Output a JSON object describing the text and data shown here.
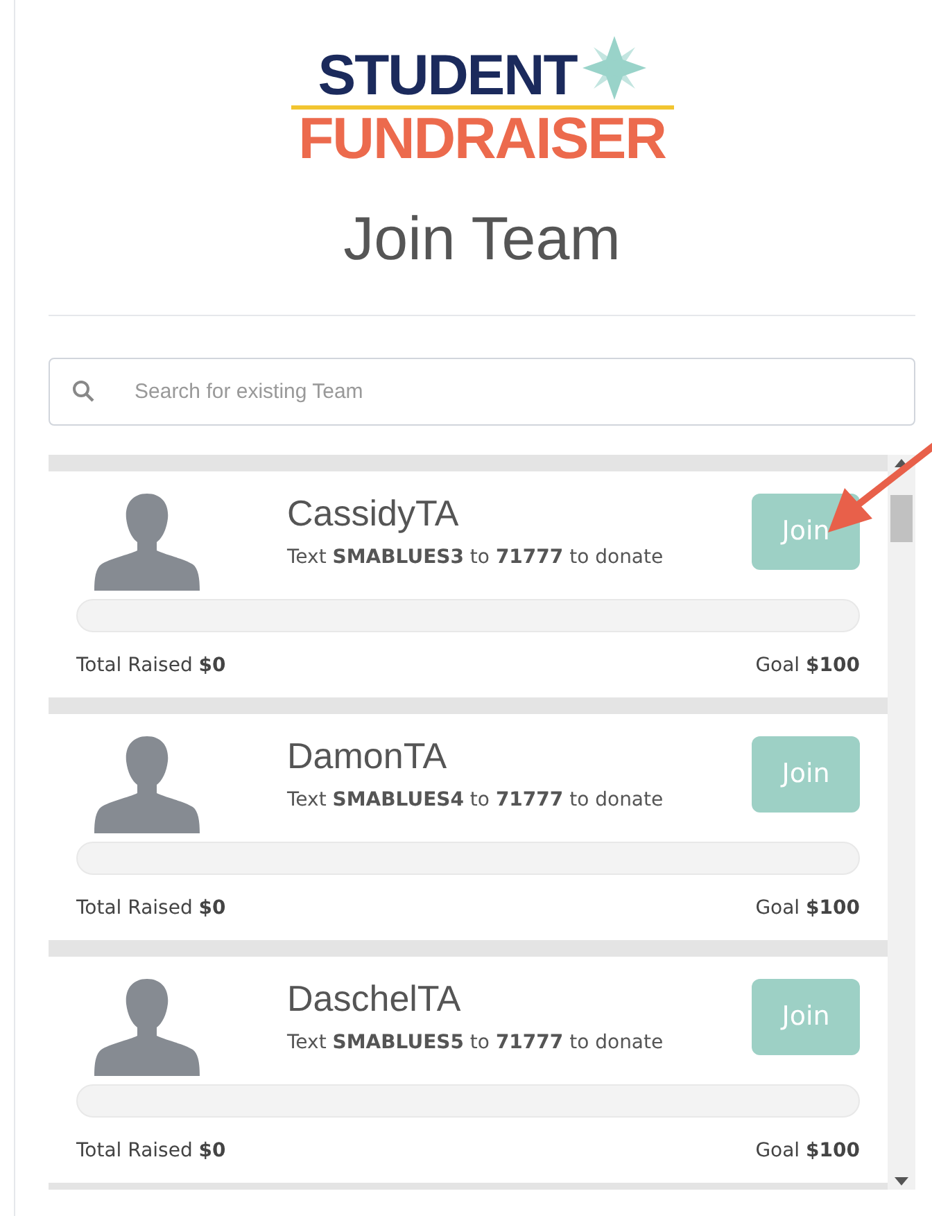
{
  "logo": {
    "line_1": "STUDENT",
    "line_2": "FUNDRAISER"
  },
  "title": "Join Team",
  "search": {
    "placeholder": "Search for existing Team"
  },
  "teams": [
    {
      "name": "CassidyTA",
      "instructions": "Text **SMABLUES3** to **71777** to donate",
      "button": "Join",
      "level": 0,
      "raised_label": "Total Raised",
      "raised": "$0",
      "goal_label": "Goal",
      "goal": "$100"
    },
    {
      "name": "DamonTA",
      "instructions": "Text **SMABLUES4** to **71777** to donate",
      "button": "Join",
      "level": 0,
      "raised_label": "Total Raised",
      "raised": "$0",
      "goal_label": "Goal",
      "goal": "$100"
    },
    {
      "name": "DaschelTA",
      "instructions": "Text **SMABLUES5** to **71777** to donate",
      "button": "Join",
      "level": 0,
      "raised_label": "Total Raised",
      "raised": "$0",
      "goal_label": "Goal",
      "goal": "$100"
    }
  ]
}
